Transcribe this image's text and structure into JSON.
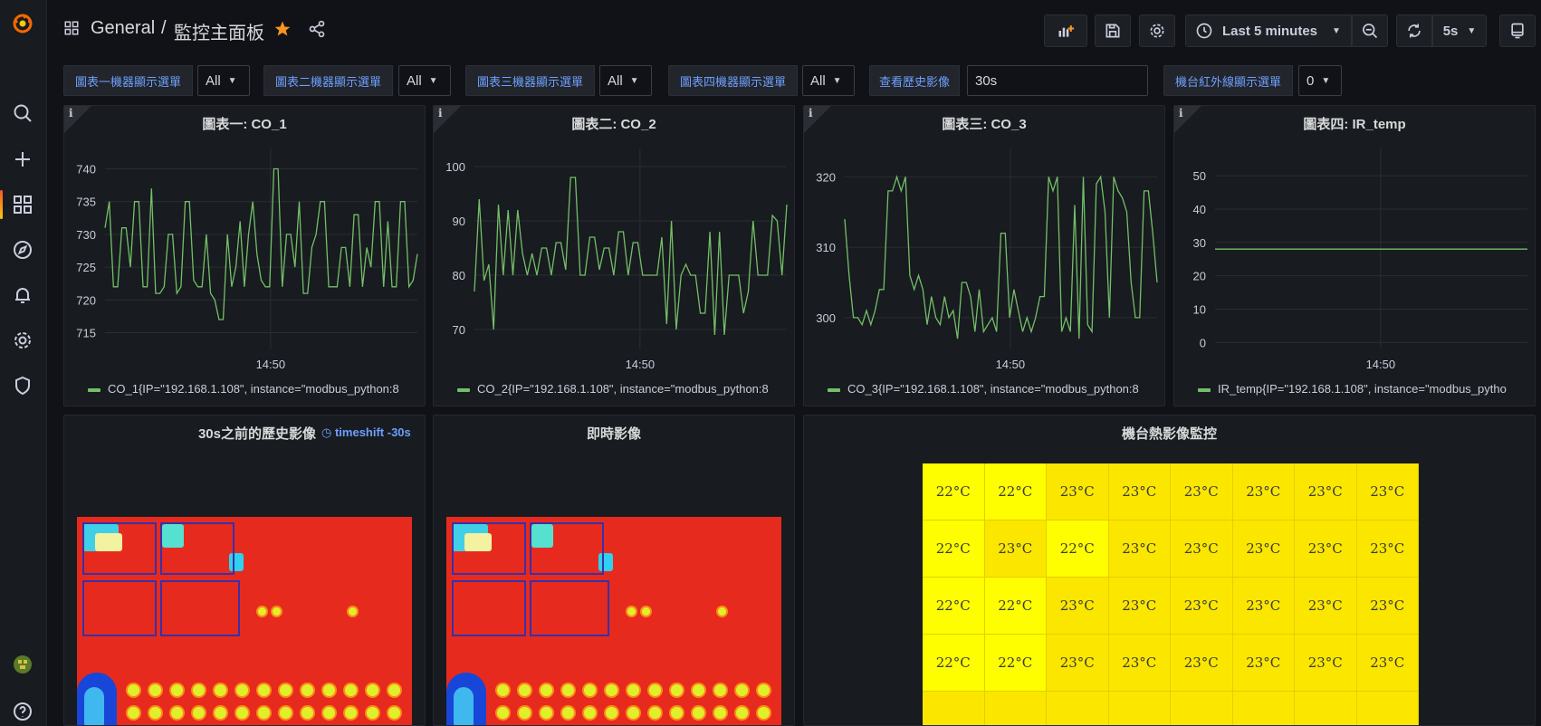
{
  "breadcrumb": {
    "folder": "General",
    "separator": "/",
    "dashboard": "監控主面板"
  },
  "time_picker": {
    "label": "Last 5 minutes"
  },
  "refresh": {
    "interval": "5s"
  },
  "variables": [
    {
      "label": "圖表一機器顯示選單",
      "value": "All"
    },
    {
      "label": "圖表二機器顯示選單",
      "value": "All"
    },
    {
      "label": "圖表三機器顯示選單",
      "value": "All"
    },
    {
      "label": "圖表四機器顯示選單",
      "value": "All"
    },
    {
      "label": "查看歷史影像",
      "value": "30s"
    },
    {
      "label": "機台紅外線顯示選單",
      "value": "0"
    }
  ],
  "panels": {
    "p1": {
      "title": "圖表一: CO_1",
      "legend": "CO_1{IP=\"192.168.1.108\", instance=\"modbus_python:8"
    },
    "p2": {
      "title": "圖表二: CO_2",
      "legend": "CO_2{IP=\"192.168.1.108\", instance=\"modbus_python:8"
    },
    "p3": {
      "title": "圖表三: CO_3",
      "legend": "CO_3{IP=\"192.168.1.108\", instance=\"modbus_python:8"
    },
    "p4": {
      "title": "圖表四: IR_temp",
      "legend": "IR_temp{IP=\"192.168.1.108\", instance=\"modbus_pytho"
    },
    "history": {
      "title": "30s之前的歷史影像",
      "timeshift": "timeshift -30s"
    },
    "live": {
      "title": "即時影像"
    },
    "heatmap": {
      "title": "機台熱影像監控"
    }
  },
  "colors": {
    "series": "#73bf69",
    "accent": "#f05a28",
    "link": "#6e9fff"
  },
  "chart_data": [
    {
      "type": "line",
      "title": "圖表一: CO_1",
      "xtick": "14:50",
      "yticks": [
        715,
        720,
        725,
        730,
        735,
        740
      ],
      "ylim": [
        713,
        742
      ],
      "series": [
        {
          "name": "CO_1{IP=\"192.168.1.108\", instance=\"modbus_python:8",
          "values": [
            731,
            735,
            722,
            722,
            731,
            731,
            725,
            735,
            735,
            722,
            722,
            737,
            721,
            721,
            722,
            730,
            730,
            721,
            722,
            735,
            735,
            723,
            722,
            722,
            730,
            721,
            720,
            717,
            717,
            730,
            722,
            725,
            732,
            722,
            730,
            735,
            727,
            723,
            722,
            722,
            740,
            740,
            722,
            730,
            730,
            725,
            735,
            721,
            721,
            728,
            730,
            735,
            735,
            722,
            722,
            722,
            728,
            728,
            722,
            733,
            733,
            722,
            728,
            725,
            735,
            735,
            722,
            732,
            722,
            722,
            735,
            735,
            722,
            723,
            727
          ]
        }
      ]
    },
    {
      "type": "line",
      "title": "圖表二: CO_2",
      "xtick": "14:50",
      "yticks": [
        70,
        80,
        90,
        100
      ],
      "ylim": [
        67,
        102
      ],
      "series": [
        {
          "name": "CO_2{IP=\"192.168.1.108\", instance=\"modbus_python:8",
          "values": [
            77,
            94,
            79,
            82,
            70,
            93,
            80,
            92,
            80,
            92,
            84,
            80,
            84,
            80,
            85,
            85,
            80,
            86,
            86,
            81,
            98,
            98,
            80,
            80,
            87,
            87,
            81,
            85,
            85,
            80,
            88,
            88,
            80,
            86,
            86,
            80,
            80,
            80,
            80,
            87,
            71,
            90,
            70,
            80,
            82,
            80,
            80,
            73,
            73,
            88,
            69,
            88,
            69,
            80,
            80,
            80,
            73,
            77,
            90,
            80,
            80,
            80,
            91,
            90,
            80,
            93
          ]
        }
      ]
    },
    {
      "type": "line",
      "title": "圖表三: CO_3",
      "xtick": "14:50",
      "yticks": [
        300,
        310,
        320
      ],
      "ylim": [
        296,
        323
      ],
      "series": [
        {
          "name": "CO_3{IP=\"192.168.1.108\", instance=\"modbus_python:8",
          "values": [
            314,
            306,
            300,
            300,
            299,
            301,
            299,
            301,
            304,
            304,
            318,
            318,
            320,
            318,
            320,
            306,
            304,
            306,
            304,
            299,
            303,
            300,
            299,
            303,
            300,
            301,
            297,
            305,
            305,
            303,
            298,
            304,
            298,
            299,
            300,
            298,
            312,
            312,
            300,
            304,
            301,
            298,
            300,
            298,
            300,
            303,
            303,
            320,
            318,
            320,
            298,
            300,
            298,
            316,
            297,
            320,
            299,
            298,
            319,
            320,
            315,
            300,
            320,
            318,
            317,
            315,
            305,
            300,
            300,
            318,
            318,
            312,
            305
          ]
        }
      ]
    },
    {
      "type": "line",
      "title": "圖表四: IR_temp",
      "xtick": "14:50",
      "yticks": [
        0,
        10,
        20,
        30,
        40,
        50
      ],
      "ylim": [
        -1,
        56
      ],
      "series": [
        {
          "name": "IR_temp{IP=\"192.168.1.108\", instance=\"modbus_pytho",
          "values": [
            28,
            28
          ]
        }
      ]
    }
  ],
  "temp_grid": [
    [
      "22°C",
      "22°C",
      "23°C",
      "23°C",
      "23°C",
      "23°C",
      "23°C",
      "23°C"
    ],
    [
      "22°C",
      "23°C",
      "22°C",
      "23°C",
      "23°C",
      "23°C",
      "23°C",
      "23°C"
    ],
    [
      "22°C",
      "22°C",
      "23°C",
      "23°C",
      "23°C",
      "23°C",
      "23°C",
      "23°C"
    ],
    [
      "22°C",
      "22°C",
      "23°C",
      "23°C",
      "23°C",
      "23°C",
      "23°C",
      "23°C"
    ],
    [
      "",
      "",
      "",
      "",
      "",
      "",
      "",
      ""
    ]
  ]
}
